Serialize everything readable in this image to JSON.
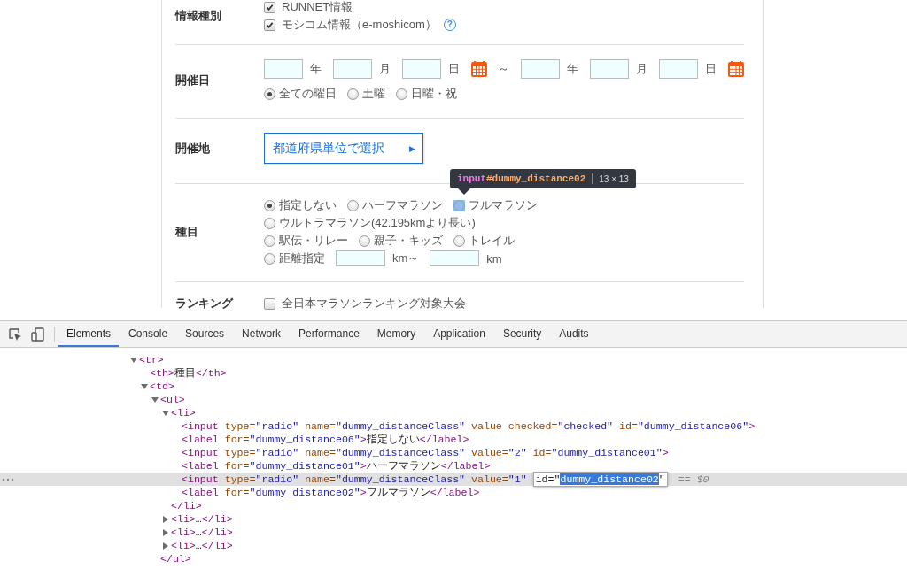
{
  "form": {
    "rows": [
      {
        "label": "情報種別",
        "kind": "checks",
        "items": [
          {
            "label": "RUNNET情報",
            "checked": true
          },
          {
            "label": "モシコム情報（e-moshicom）",
            "checked": true,
            "help": "?"
          }
        ]
      },
      {
        "label": "開催日",
        "kind": "date",
        "from": {
          "year_unit": "年",
          "month_unit": "月",
          "day_unit": "日"
        },
        "separator": "～",
        "to": {
          "year_unit": "年",
          "month_unit": "月",
          "day_unit": "日"
        },
        "weekdays": [
          {
            "label": "全ての曜日",
            "selected": true
          },
          {
            "label": "土曜",
            "selected": false
          },
          {
            "label": "日曜・祝",
            "selected": false
          }
        ]
      },
      {
        "label": "開催地",
        "kind": "select_button",
        "button": {
          "label": "都道府県単位で選択",
          "arrow": "▶"
        }
      },
      {
        "label": "種目",
        "kind": "radio_lines",
        "lines": [
          [
            {
              "label": "指定しない",
              "selected": true,
              "highlighted": false
            },
            {
              "label": "ハーフマラソン",
              "selected": false,
              "highlighted": false
            },
            {
              "label": "フルマラソン",
              "selected": false,
              "highlighted": true
            }
          ],
          [
            {
              "label": "ウルトラマラソン(42.195kmより長い)",
              "selected": false,
              "highlighted": false
            }
          ],
          [
            {
              "label": "駅伝・リレー",
              "selected": false,
              "highlighted": false
            },
            {
              "label": "親子・キッズ",
              "selected": false,
              "highlighted": false
            },
            {
              "label": "トレイル",
              "selected": false,
              "highlighted": false
            }
          ],
          [
            {
              "label": "距離指定",
              "selected": false,
              "highlighted": false,
              "range": {
                "from_unit": "km～",
                "to_unit": "km"
              }
            }
          ]
        ]
      },
      {
        "label": "ランキング",
        "kind": "checks",
        "items": [
          {
            "label": "全日本マラソンランキング対象大会",
            "checked": false
          }
        ]
      }
    ]
  },
  "tooltip": {
    "selector_tag": "input",
    "selector_id": "#dummy_distance02",
    "size": "13 × 13"
  },
  "devtools": {
    "tabs": [
      {
        "label": "Elements",
        "selected": true
      },
      {
        "label": "Console",
        "selected": false
      },
      {
        "label": "Sources",
        "selected": false
      },
      {
        "label": "Network",
        "selected": false
      },
      {
        "label": "Performance",
        "selected": false
      },
      {
        "label": "Memory",
        "selected": false
      },
      {
        "label": "Application",
        "selected": false
      },
      {
        "label": "Security",
        "selected": false
      },
      {
        "label": "Audits",
        "selected": false
      }
    ],
    "dom_tree": [
      {
        "selected": false,
        "expanded": true,
        "tokens": [
          {
            "kind": "tag",
            "text": "<tr>"
          }
        ],
        "children": [
          {
            "selected": false,
            "tokens": [
              {
                "kind": "tag",
                "text": "<th>"
              },
              {
                "kind": "text",
                "text": "種目"
              },
              {
                "kind": "tag",
                "text": "</th>"
              }
            ]
          },
          {
            "selected": false,
            "expanded": true,
            "tokens": [
              {
                "kind": "tag",
                "text": "<td>"
              }
            ],
            "children": [
              {
                "selected": false,
                "expanded": true,
                "tokens": [
                  {
                    "kind": "tag",
                    "text": "<ul>"
                  }
                ],
                "close": [
                  {
                    "kind": "tag",
                    "text": "</ul>"
                  }
                ],
                "children": [
                  {
                    "selected": false,
                    "expanded": true,
                    "tokens": [
                      {
                        "kind": "tag",
                        "text": "<li>"
                      }
                    ],
                    "close": [
                      {
                        "kind": "tag",
                        "text": "</li>"
                      }
                    ],
                    "children": [
                      {
                        "selected": false,
                        "tokens": [
                          {
                            "kind": "tag",
                            "text": "<input"
                          },
                          {
                            "kind": "attr",
                            "text": " type="
                          },
                          {
                            "kind": "value",
                            "text": "\"radio\""
                          },
                          {
                            "kind": "attr",
                            "text": " name="
                          },
                          {
                            "kind": "value",
                            "text": "\"dummy_distanceClass\""
                          },
                          {
                            "kind": "attr",
                            "text": " value checked="
                          },
                          {
                            "kind": "value",
                            "text": "\"checked\""
                          },
                          {
                            "kind": "attr",
                            "text": " id="
                          },
                          {
                            "kind": "value",
                            "text": "\"dummy_distance06\""
                          },
                          {
                            "kind": "tag",
                            "text": ">"
                          }
                        ]
                      },
                      {
                        "selected": false,
                        "tokens": [
                          {
                            "kind": "tag",
                            "text": "<label"
                          },
                          {
                            "kind": "attr",
                            "text": " for="
                          },
                          {
                            "kind": "value",
                            "text": "\"dummy_distance06\""
                          },
                          {
                            "kind": "tag",
                            "text": ">"
                          },
                          {
                            "kind": "text",
                            "text": "指定しない"
                          },
                          {
                            "kind": "tag",
                            "text": "</label>"
                          }
                        ]
                      },
                      {
                        "selected": false,
                        "tokens": [
                          {
                            "kind": "tag",
                            "text": "<input"
                          },
                          {
                            "kind": "attr",
                            "text": " type="
                          },
                          {
                            "kind": "value",
                            "text": "\"radio\""
                          },
                          {
                            "kind": "attr",
                            "text": " name="
                          },
                          {
                            "kind": "value",
                            "text": "\"dummy_distanceClass\""
                          },
                          {
                            "kind": "attr",
                            "text": " value="
                          },
                          {
                            "kind": "value",
                            "text": "\"2\""
                          },
                          {
                            "kind": "attr",
                            "text": " id="
                          },
                          {
                            "kind": "value",
                            "text": "\"dummy_distance01\""
                          },
                          {
                            "kind": "tag",
                            "text": ">"
                          }
                        ]
                      },
                      {
                        "selected": false,
                        "tokens": [
                          {
                            "kind": "tag",
                            "text": "<label"
                          },
                          {
                            "kind": "attr",
                            "text": " for="
                          },
                          {
                            "kind": "value",
                            "text": "\"dummy_distance01\""
                          },
                          {
                            "kind": "tag",
                            "text": ">"
                          },
                          {
                            "kind": "text",
                            "text": "ハーフマラソン"
                          },
                          {
                            "kind": "tag",
                            "text": "</label>"
                          }
                        ]
                      },
                      {
                        "selected": true,
                        "tokens": [
                          {
                            "kind": "tag",
                            "text": "<input"
                          },
                          {
                            "kind": "attr",
                            "text": " type="
                          },
                          {
                            "kind": "value",
                            "text": "\"radio\""
                          },
                          {
                            "kind": "attr",
                            "text": " name="
                          },
                          {
                            "kind": "value",
                            "text": "\"dummy_distanceClass\""
                          },
                          {
                            "kind": "attr",
                            "text": " value="
                          },
                          {
                            "kind": "value",
                            "text": "\"1\""
                          },
                          {
                            "kind": "edit",
                            "text": "id=\"",
                            "selected_text": "dummy_distance02",
                            "suffix": "\""
                          },
                          {
                            "kind": "hint",
                            "text": "== $0"
                          }
                        ]
                      },
                      {
                        "selected": false,
                        "tokens": [
                          {
                            "kind": "tag",
                            "text": "<label"
                          },
                          {
                            "kind": "attr",
                            "text": " for="
                          },
                          {
                            "kind": "value",
                            "text": "\"dummy_distance02\""
                          },
                          {
                            "kind": "tag",
                            "text": ">"
                          },
                          {
                            "kind": "text",
                            "text": "フルマラソン"
                          },
                          {
                            "kind": "tag",
                            "text": "</label>"
                          }
                        ]
                      }
                    ]
                  },
                  {
                    "selected": false,
                    "expanded": false,
                    "tokens": [
                      {
                        "kind": "tag",
                        "text": "<li>"
                      },
                      {
                        "kind": "text",
                        "text": "…"
                      },
                      {
                        "kind": "tag",
                        "text": "</li>"
                      }
                    ]
                  },
                  {
                    "selected": false,
                    "expanded": false,
                    "tokens": [
                      {
                        "kind": "tag",
                        "text": "<li>"
                      },
                      {
                        "kind": "text",
                        "text": "…"
                      },
                      {
                        "kind": "tag",
                        "text": "</li>"
                      }
                    ]
                  },
                  {
                    "selected": false,
                    "expanded": false,
                    "tokens": [
                      {
                        "kind": "tag",
                        "text": "<li>"
                      },
                      {
                        "kind": "text",
                        "text": "…"
                      },
                      {
                        "kind": "tag",
                        "text": "</li>"
                      }
                    ]
                  }
                ]
              }
            ]
          }
        ]
      }
    ]
  }
}
